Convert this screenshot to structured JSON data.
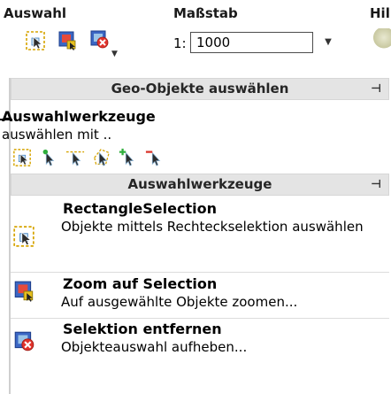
{
  "ribbon": {
    "groups": [
      {
        "title": "Auswahl"
      },
      {
        "title": "Maßstab"
      },
      {
        "title": "Hil"
      }
    ],
    "scale": {
      "prefix": "1:",
      "value": "1000"
    }
  },
  "panel": {
    "header": "Geo-Objekte auswählen",
    "subtitle": "Auswahlwerkzeuge",
    "description": "auswählen mit ..",
    "section_header": "Auswahlwerkzeuge",
    "items": [
      {
        "title": "RectangleSelection",
        "desc": "Objekte mittels Rechteckselektion auswählen"
      },
      {
        "title": "Zoom auf Selection",
        "desc": "Auf ausgewählte Objekte zoomen..."
      },
      {
        "title": "Selektion entfernen",
        "desc": "Objekteauswahl aufheben..."
      }
    ]
  },
  "icons": {
    "rect_select": "rectangle-selection-icon",
    "zoom_select": "zoom-to-selection-icon",
    "remove_select": "remove-selection-icon"
  },
  "colors": {
    "header_bg": "#e4e4e4",
    "selection_yellow": "#e6b800",
    "accent_red": "#d9342b",
    "accent_green": "#2fae3c"
  }
}
